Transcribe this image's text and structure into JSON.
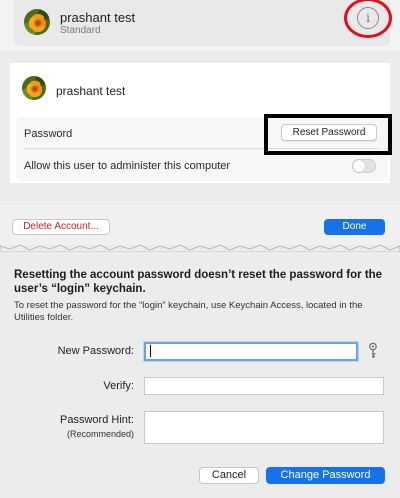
{
  "user_list": {
    "user_name": "prashant test",
    "user_role": "Standard",
    "info_icon": "info-icon"
  },
  "user_details": {
    "user_name": "prashant test",
    "password_label": "Password",
    "reset_password_label": "Reset Password",
    "admin_label": "Allow this user to administer this computer",
    "admin_enabled": false
  },
  "footer": {
    "delete_account_label": "Delete Account...",
    "done_label": "Done"
  },
  "reset_dialog": {
    "headline": "Resetting the account password doesn’t reset the password for the user’s “login” keychain.",
    "explanation": "To reset the password for the “login” keychain, use Keychain Access, located in the Utilities folder.",
    "new_password_label": "New Password:",
    "new_password_value": "",
    "verify_label": "Verify:",
    "verify_value": "",
    "hint_label": "Password Hint:",
    "hint_sublabel": "(Recommended)",
    "hint_value": "",
    "key_icon": "key-icon",
    "cancel_label": "Cancel",
    "change_password_label": "Change Password"
  },
  "colors": {
    "accent_blue": "#1572e8",
    "highlight_red": "#e0101a",
    "delete_red": "#d42020"
  }
}
